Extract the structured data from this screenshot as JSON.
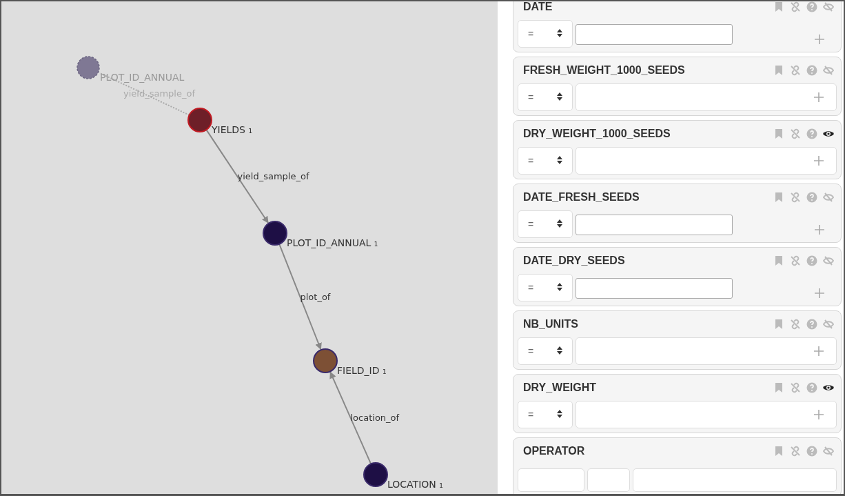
{
  "graph": {
    "nodes": [
      {
        "label": "PLOT_ID_ANNUAL",
        "color": "#7f7894",
        "ghost": true
      },
      {
        "label": "YIELDS ₁",
        "color": "#6e1f28",
        "ghost": false
      },
      {
        "label": "PLOT_ID_ANNUAL ₁",
        "color": "#1e0f45",
        "ghost": false
      },
      {
        "label": "FIELD_ID ₁",
        "color": "#7d5035",
        "ghost": false
      },
      {
        "label": "LOCATION ₁",
        "color": "#1e0f45",
        "ghost": false
      }
    ],
    "edges": [
      {
        "label": "yield_sample_of",
        "ghost": true
      },
      {
        "label": "yield_sample_of",
        "ghost": false
      },
      {
        "label": "plot_of",
        "ghost": false
      },
      {
        "label": "location_of",
        "ghost": false
      }
    ]
  },
  "filters": [
    {
      "name": "DATE",
      "kind": "date",
      "operator": "=",
      "visible": false
    },
    {
      "name": "FRESH_WEIGHT_1000_SEEDS",
      "kind": "text",
      "operator": "=",
      "visible": false
    },
    {
      "name": "DRY_WEIGHT_1000_SEEDS",
      "kind": "text",
      "operator": "=",
      "visible": true
    },
    {
      "name": "DATE_FRESH_SEEDS",
      "kind": "date",
      "operator": "=",
      "visible": false
    },
    {
      "name": "DATE_DRY_SEEDS",
      "kind": "date",
      "operator": "=",
      "visible": false
    },
    {
      "name": "NB_UNITS",
      "kind": "text",
      "operator": "=",
      "visible": false
    },
    {
      "name": "DRY_WEIGHT",
      "kind": "text",
      "operator": "=",
      "visible": true
    },
    {
      "name": "OPERATOR",
      "kind": "partial",
      "visible": false
    }
  ]
}
